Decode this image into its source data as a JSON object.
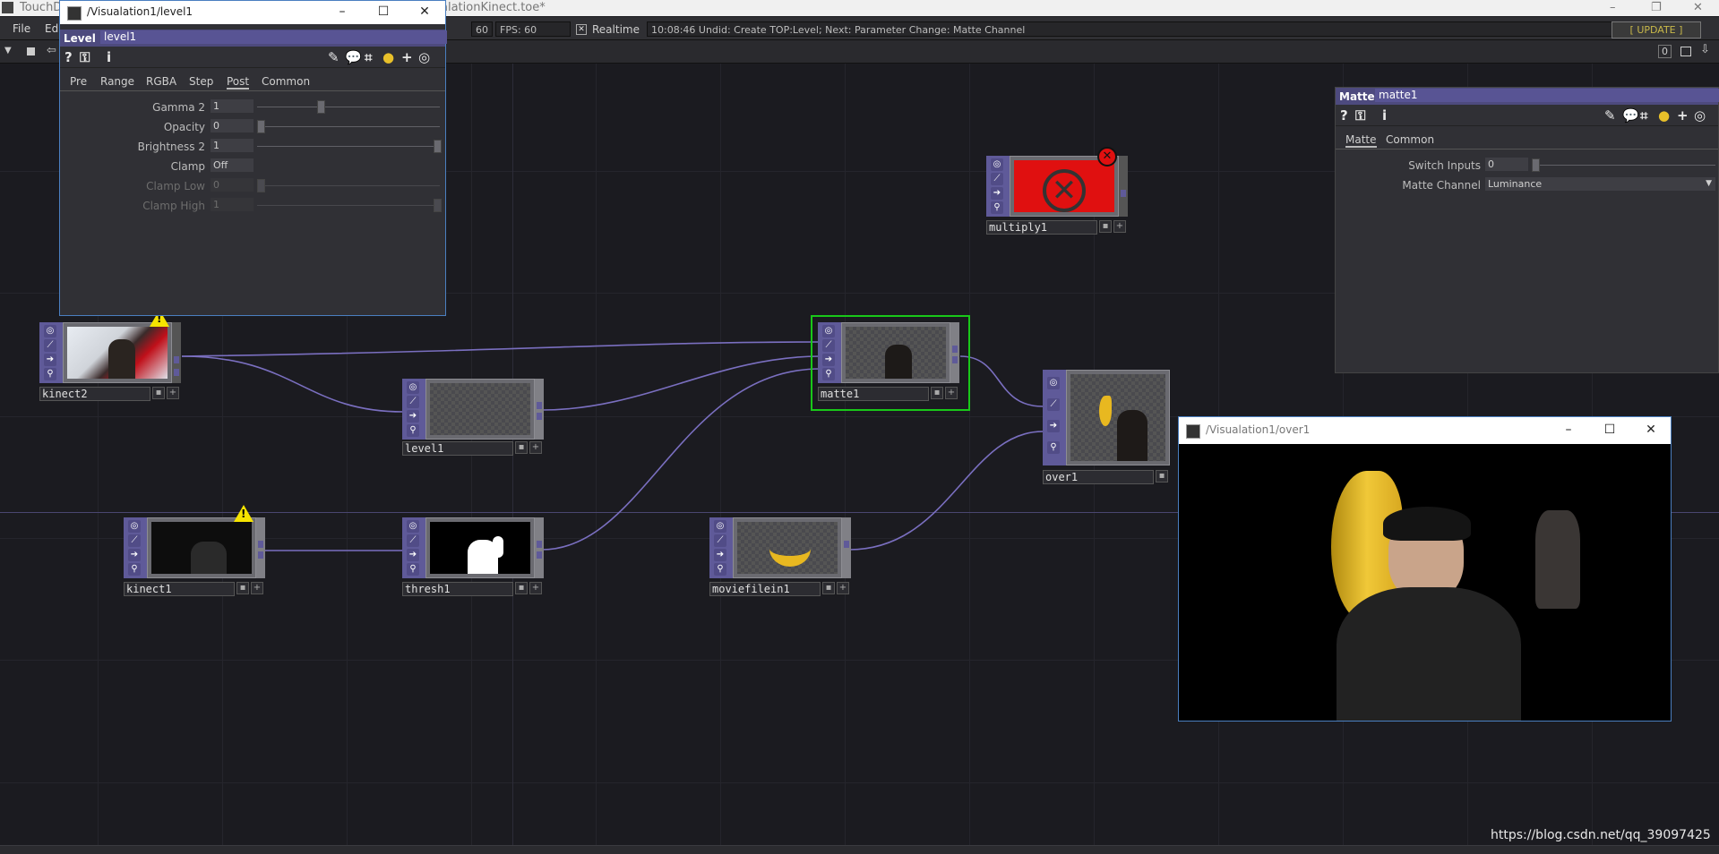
{
  "app": {
    "title_left": "TouchD",
    "title_file": "alationKinect.toe*"
  },
  "menu": {
    "file": "File",
    "edit": "Edi"
  },
  "status": {
    "fps_val": "60",
    "fps_label": "FPS:",
    "fps": "60",
    "realtime": "Realtime",
    "undo": "10:08:46 Undid: Create TOP:Level; Next: Parameter Change: Matte Channel",
    "update": "[ UPDATE ]"
  },
  "zoom_readout": "0",
  "level_dialog": {
    "title": "/Visualation1/level1",
    "op_type": "Level",
    "op_name": "level1",
    "tabs": [
      "Pre",
      "Range",
      "RGBA",
      "Step",
      "Post",
      "Common"
    ],
    "params": [
      {
        "label": "Gamma 2",
        "value": "1"
      },
      {
        "label": "Opacity",
        "value": "0"
      },
      {
        "label": "Brightness 2",
        "value": "1"
      },
      {
        "label": "Clamp",
        "value": "Off"
      },
      {
        "label": "Clamp Low",
        "value": "0"
      },
      {
        "label": "Clamp High",
        "value": "1"
      }
    ]
  },
  "matte_panel": {
    "op_type": "Matte",
    "op_name": "matte1",
    "tabs": [
      "Matte",
      "Common"
    ],
    "params": [
      {
        "label": "Switch Inputs",
        "value": "0"
      },
      {
        "label": "Matte Channel",
        "value": "Luminance"
      }
    ]
  },
  "nodes": {
    "kinect2": "kinect2",
    "level1": "level1",
    "matte1": "matte1",
    "multiply1": "multiply1",
    "over1": "over1",
    "kinect1": "kinect1",
    "thresh1": "thresh1",
    "moviefilein1": "moviefilein1"
  },
  "viewer": {
    "title": "/Visualation1/over1"
  },
  "watermark": "https://blog.csdn.net/qq_39097425",
  "colors": {
    "accent": "#5f5a99",
    "selected": "#19c819",
    "annotation": "#e02020"
  }
}
